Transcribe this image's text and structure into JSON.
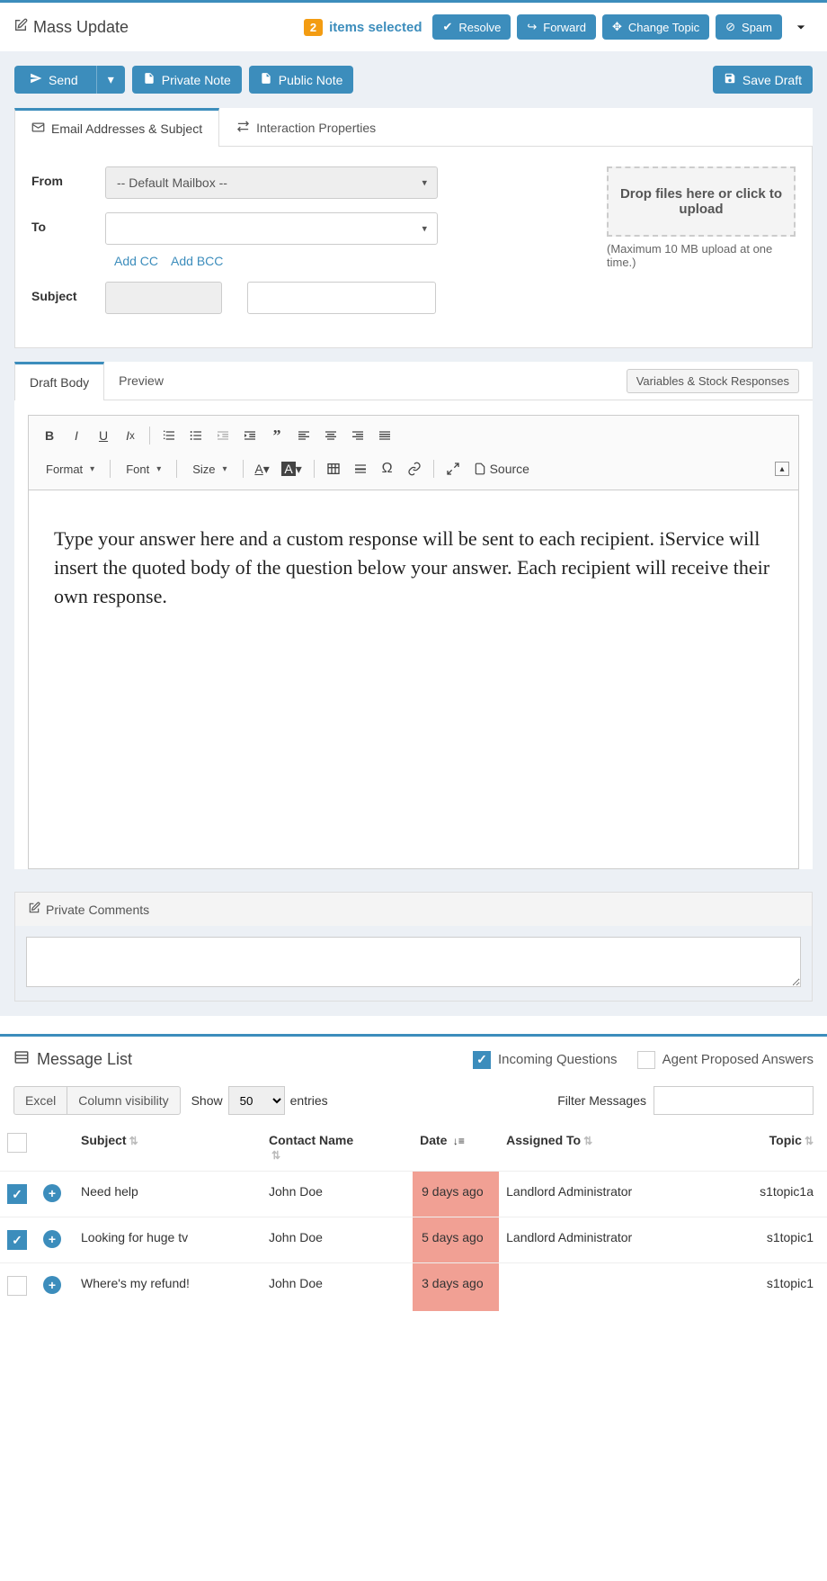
{
  "massUpdate": {
    "title": "Mass Update",
    "selectedCount": "2",
    "selectedLabel": "items selected",
    "buttons": {
      "resolve": "Resolve",
      "forward": "Forward",
      "changeTopic": "Change Topic",
      "spam": "Spam"
    }
  },
  "compose": {
    "send": "Send",
    "privateNote": "Private Note",
    "publicNote": "Public Note",
    "saveDraft": "Save Draft"
  },
  "tabs": {
    "email": "Email Addresses & Subject",
    "interaction": "Interaction Properties"
  },
  "form": {
    "from": "From",
    "fromValue": "-- Default Mailbox --",
    "to": "To",
    "addCC": "Add CC",
    "addBCC": "Add BCC",
    "subject": "Subject",
    "dropzone": "Drop files here or click to upload",
    "uploadNote": "(Maximum 10 MB upload at one time.)"
  },
  "bodyTabs": {
    "draft": "Draft Body",
    "preview": "Preview",
    "variables": "Variables & Stock Responses"
  },
  "toolbar": {
    "format": "Format",
    "font": "Font",
    "size": "Size",
    "source": "Source"
  },
  "editorBody": "Type your answer here and a custom response will be sent to each recipient. iService will insert the quoted body of the question below your answer. Each recipient will receive their own response.",
  "comments": {
    "label": "Private Comments"
  },
  "messageList": {
    "title": "Message List",
    "incoming": "Incoming Questions",
    "proposed": "Agent Proposed Answers",
    "excel": "Excel",
    "colVis": "Column visibility",
    "show": "Show",
    "showValue": "50",
    "entries": "entries",
    "filter": "Filter Messages",
    "headers": {
      "subject": "Subject",
      "contact": "Contact Name",
      "date": "Date",
      "assigned": "Assigned To",
      "topic": "Topic"
    },
    "rows": [
      {
        "checked": true,
        "subject": "Need help",
        "contact": "John Doe",
        "date": "9 days ago",
        "assigned": "Landlord Administrator",
        "topic": "s1topic1a",
        "highlight": false
      },
      {
        "checked": true,
        "subject": "Looking for huge tv",
        "contact": "John Doe",
        "date": "5 days ago",
        "assigned": "Landlord Administrator",
        "topic": "s1topic1",
        "highlight": false
      },
      {
        "checked": false,
        "subject": "Where's my refund!",
        "contact": "John Doe",
        "date": "3 days ago",
        "assigned": "",
        "topic": "s1topic1",
        "highlight": true
      }
    ]
  }
}
